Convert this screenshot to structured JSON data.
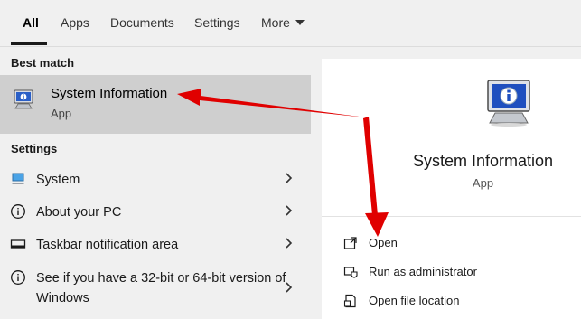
{
  "tabs": [
    {
      "label": "All",
      "active": true
    },
    {
      "label": "Apps"
    },
    {
      "label": "Documents"
    },
    {
      "label": "Settings"
    },
    {
      "label": "More"
    }
  ],
  "left": {
    "best_match_heading": "Best match",
    "best_match": {
      "title": "System Information",
      "subtitle": "App",
      "icon": "system-information-icon"
    },
    "settings_heading": "Settings",
    "settings_items": [
      {
        "label": "System",
        "icon": "laptop-icon"
      },
      {
        "label": "About your PC",
        "icon": "info-circle-icon"
      },
      {
        "label": "Taskbar notification area",
        "icon": "taskbar-icon"
      },
      {
        "label": "See if you have a 32-bit or 64-bit version of Windows",
        "icon": "info-circle-icon"
      }
    ]
  },
  "right": {
    "app_name": "System Information",
    "app_type": "App",
    "actions": [
      {
        "label": "Open",
        "icon": "open-icon"
      },
      {
        "label": "Run as administrator",
        "icon": "shield-icon"
      },
      {
        "label": "Open file location",
        "icon": "file-location-icon"
      }
    ]
  },
  "colors": {
    "arrow": "#e00000",
    "highlight": "#cfcfcf",
    "pane_bg": "#f0f0f0",
    "detail_bg": "#ffffff"
  }
}
